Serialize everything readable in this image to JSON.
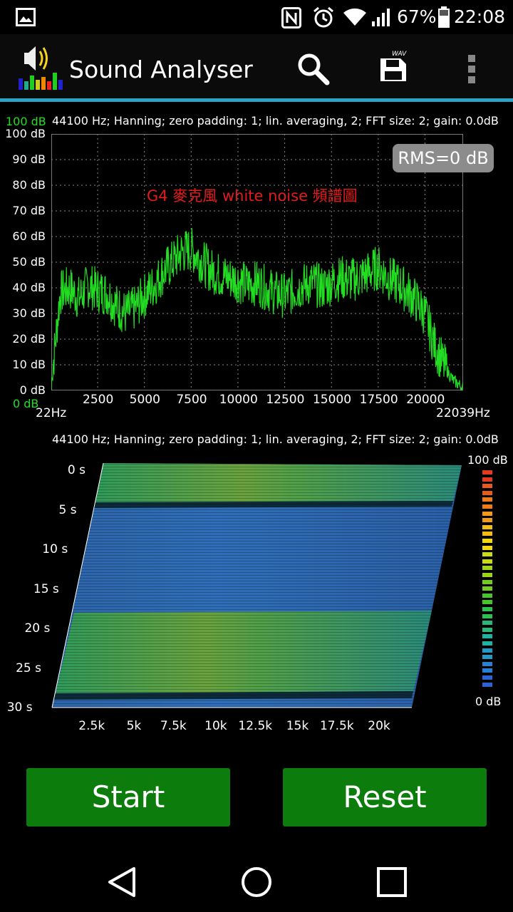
{
  "status_bar": {
    "battery": "67%",
    "time": "22:08"
  },
  "app": {
    "title": "Sound Analyser"
  },
  "spectrum": {
    "info": "44100 Hz; Hanning; zero padding: 1; lin. averaging, 2; FFT size: 2; gain: 0.0dB",
    "top_db_label": "100 dB",
    "bottom_db_label": "0 dB",
    "y_ticks": [
      "100 dB",
      "90 dB",
      "80 dB",
      "70 dB",
      "60 dB",
      "50 dB",
      "40 dB",
      "30 dB",
      "20 dB",
      "10 dB",
      "0 dB"
    ],
    "x_ticks": [
      "2500",
      "5000",
      "7500",
      "10000",
      "12500",
      "15000",
      "17500",
      "20000"
    ],
    "x_min_label": "22Hz",
    "x_max_label": "22039Hz",
    "rms": "RMS=0 dB",
    "annotation": "G4 麥克風 white noise 頻譜圖"
  },
  "chart_data": {
    "type": "line",
    "xlabel": "",
    "ylabel": "",
    "xlim": [
      22,
      22039
    ],
    "ylim": [
      0,
      100
    ],
    "grid": true,
    "x": [
      22,
      500,
      1000,
      1500,
      2000,
      2500,
      3000,
      3500,
      4000,
      4500,
      5000,
      5500,
      6000,
      6500,
      7000,
      7500,
      8000,
      8500,
      9000,
      9500,
      10000,
      10500,
      11000,
      11500,
      12000,
      12500,
      13000,
      13500,
      14000,
      14500,
      15000,
      15500,
      16000,
      16500,
      17000,
      17500,
      18000,
      18500,
      19000,
      19500,
      20000,
      20500,
      21000,
      21500,
      22039
    ],
    "series": [
      {
        "values": [
          3,
          38,
          40,
          36,
          41,
          39,
          38,
          33,
          30,
          32,
          37,
          41,
          46,
          50,
          54,
          55,
          51,
          47,
          45,
          44,
          43,
          41,
          42,
          40,
          38,
          37,
          39,
          41,
          42,
          40,
          42,
          44,
          43,
          44,
          46,
          48,
          44,
          42,
          39,
          35,
          30,
          18,
          10,
          4,
          1
        ]
      }
    ]
  },
  "spectrogram": {
    "info": "44100 Hz; Hanning; zero padding: 1; lin. averaging, 2; FFT size: 2; gain: 0.0dB",
    "time_ticks": [
      "0 s",
      "5 s",
      "10 s",
      "15 s",
      "20 s",
      "25 s",
      "30 s"
    ],
    "freq_ticks": [
      "2.5k",
      "5k",
      "7.5k",
      "10k",
      "12.5k",
      "15k",
      "17.5k",
      "20k"
    ],
    "legend_max": "100 dB",
    "legend_min": "0 dB"
  },
  "buttons": {
    "start": "Start",
    "reset": "Reset"
  },
  "colors": {
    "trace": "#22dd22",
    "accent": "#29a3c9",
    "button": "#0c7d0c",
    "annotation": "#e41b1b"
  }
}
